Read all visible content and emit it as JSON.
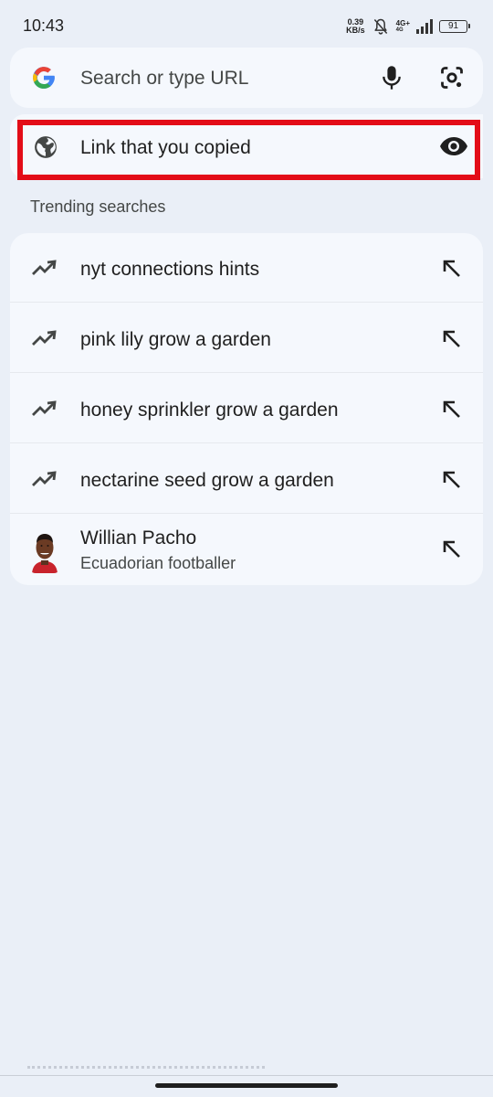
{
  "status_bar": {
    "time": "10:43",
    "net_speed_value": "0.39",
    "net_speed_unit": "KB/s",
    "network_type": "4G+",
    "network_sub": "4G",
    "battery": "91"
  },
  "search": {
    "placeholder": "Search or type URL",
    "icons": [
      "google-logo-icon",
      "mic-icon",
      "lens-icon"
    ]
  },
  "clipboard": {
    "label": "Link that you copied",
    "icons": [
      "globe-icon",
      "eye-icon"
    ],
    "highlight_color": "#e30d18"
  },
  "trending": {
    "title": "Trending searches",
    "items": [
      {
        "text": "nyt connections hints",
        "icon": "trending-up-icon"
      },
      {
        "text": "pink lily grow a garden",
        "icon": "trending-up-icon"
      },
      {
        "text": "honey sprinkler grow a garden",
        "icon": "trending-up-icon"
      },
      {
        "text": "nectarine seed grow a garden",
        "icon": "trending-up-icon"
      }
    ],
    "entity": {
      "title": "Willian Pacho",
      "subtitle": "Ecuadorian footballer",
      "icon": "avatar-image"
    }
  },
  "colors": {
    "background": "#eaeff7",
    "card": "#f5f8fd",
    "text": "#1f1f1f",
    "secondary_text": "#444746"
  }
}
